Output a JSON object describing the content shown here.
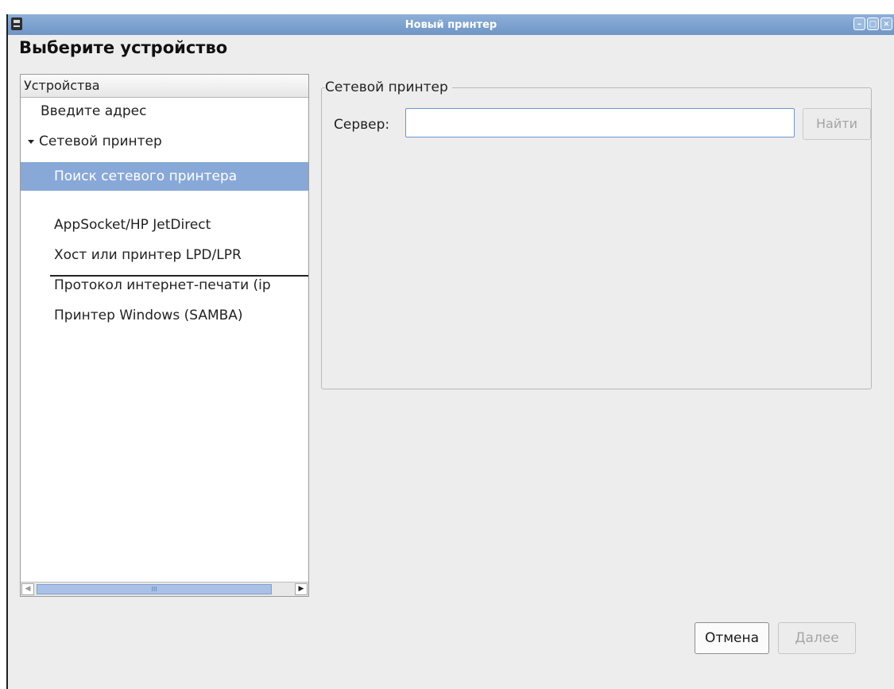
{
  "window": {
    "title": "Новый принтер",
    "buttons": [
      "minimize",
      "maximize",
      "close"
    ]
  },
  "heading": "Выберите устройство",
  "devices": {
    "header": "Устройства",
    "items": [
      {
        "label": "Введите адрес"
      },
      {
        "label": "Сетевой принтер",
        "expanded": true
      },
      {
        "label": "Поиск сетевого принтера",
        "selected": true
      },
      {
        "label": "AppSocket/HP JetDirect"
      },
      {
        "label": "Хост или принтер LPD/LPR"
      },
      {
        "label": "Протокол интернет-печати (ip"
      },
      {
        "label": "Принтер Windows (SAMBA)"
      }
    ],
    "scrollbar_thumb_glyph": "III"
  },
  "network_panel": {
    "legend": "Сетевой принтер",
    "server_label": "Сервер:",
    "server_value": "",
    "find_label": "Найти"
  },
  "footer": {
    "cancel_label": "Отмена",
    "next_label": "Далее"
  },
  "colors": {
    "titlebar": "#7aa0cf",
    "selection": "#88a8d8",
    "input_focus_border": "#6f95cf"
  }
}
